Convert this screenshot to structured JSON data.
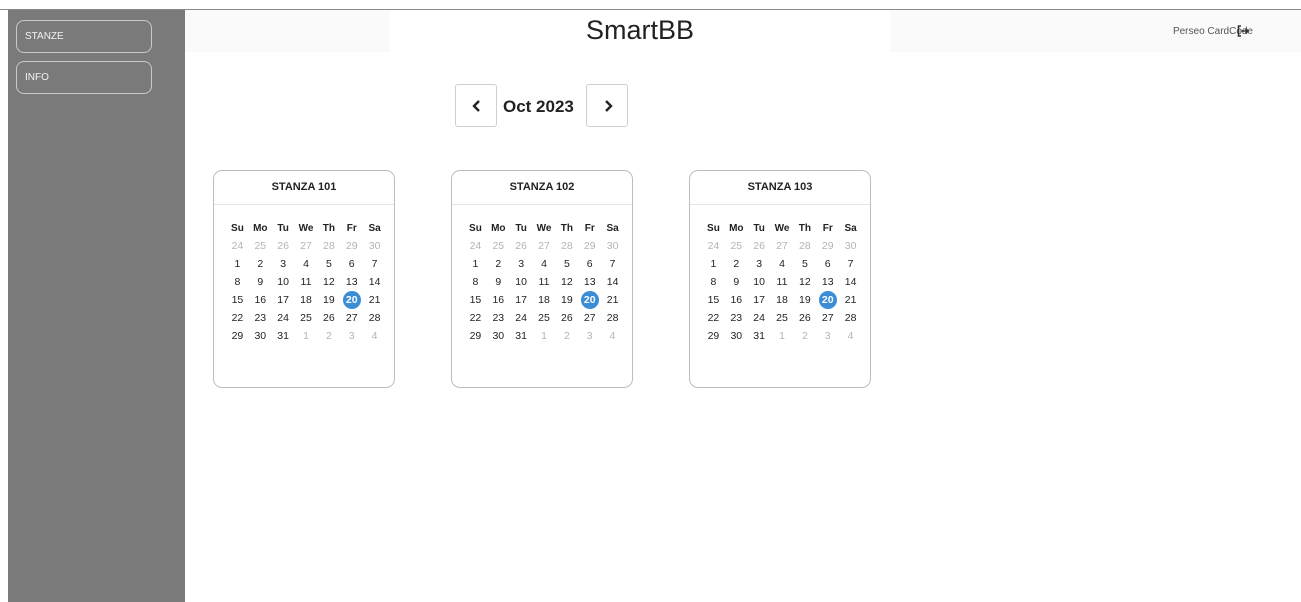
{
  "app": {
    "title": "SmartBB"
  },
  "sidebar": {
    "items": [
      {
        "label": "STANZE"
      },
      {
        "label": "INFO"
      }
    ]
  },
  "header": {
    "user_label": "Perseo CardCode",
    "logout_icon": "logout-icon"
  },
  "calendar_nav": {
    "month": "Oct 2023",
    "prev_icon": "chevron-left-icon",
    "next_icon": "chevron-right-icon"
  },
  "weekdays": [
    "Su",
    "Mo",
    "Tu",
    "We",
    "Th",
    "Fr",
    "Sa"
  ],
  "weeks": [
    [
      "24",
      "25",
      "26",
      "27",
      "28",
      "29",
      "30"
    ],
    [
      "1",
      "2",
      "3",
      "4",
      "5",
      "6",
      "7"
    ],
    [
      "8",
      "9",
      "10",
      "11",
      "12",
      "13",
      "14"
    ],
    [
      "15",
      "16",
      "17",
      "18",
      "19",
      "20",
      "21"
    ],
    [
      "22",
      "23",
      "24",
      "25",
      "26",
      "27",
      "28"
    ],
    [
      "29",
      "30",
      "31",
      "1",
      "2",
      "3",
      "4"
    ]
  ],
  "today": "20",
  "rooms": [
    {
      "name": "STANZA 101"
    },
    {
      "name": "STANZA 102"
    },
    {
      "name": "STANZA 103"
    }
  ],
  "colors": {
    "sidebar": "#7a7a7a",
    "highlight": "#3b8ed6"
  }
}
